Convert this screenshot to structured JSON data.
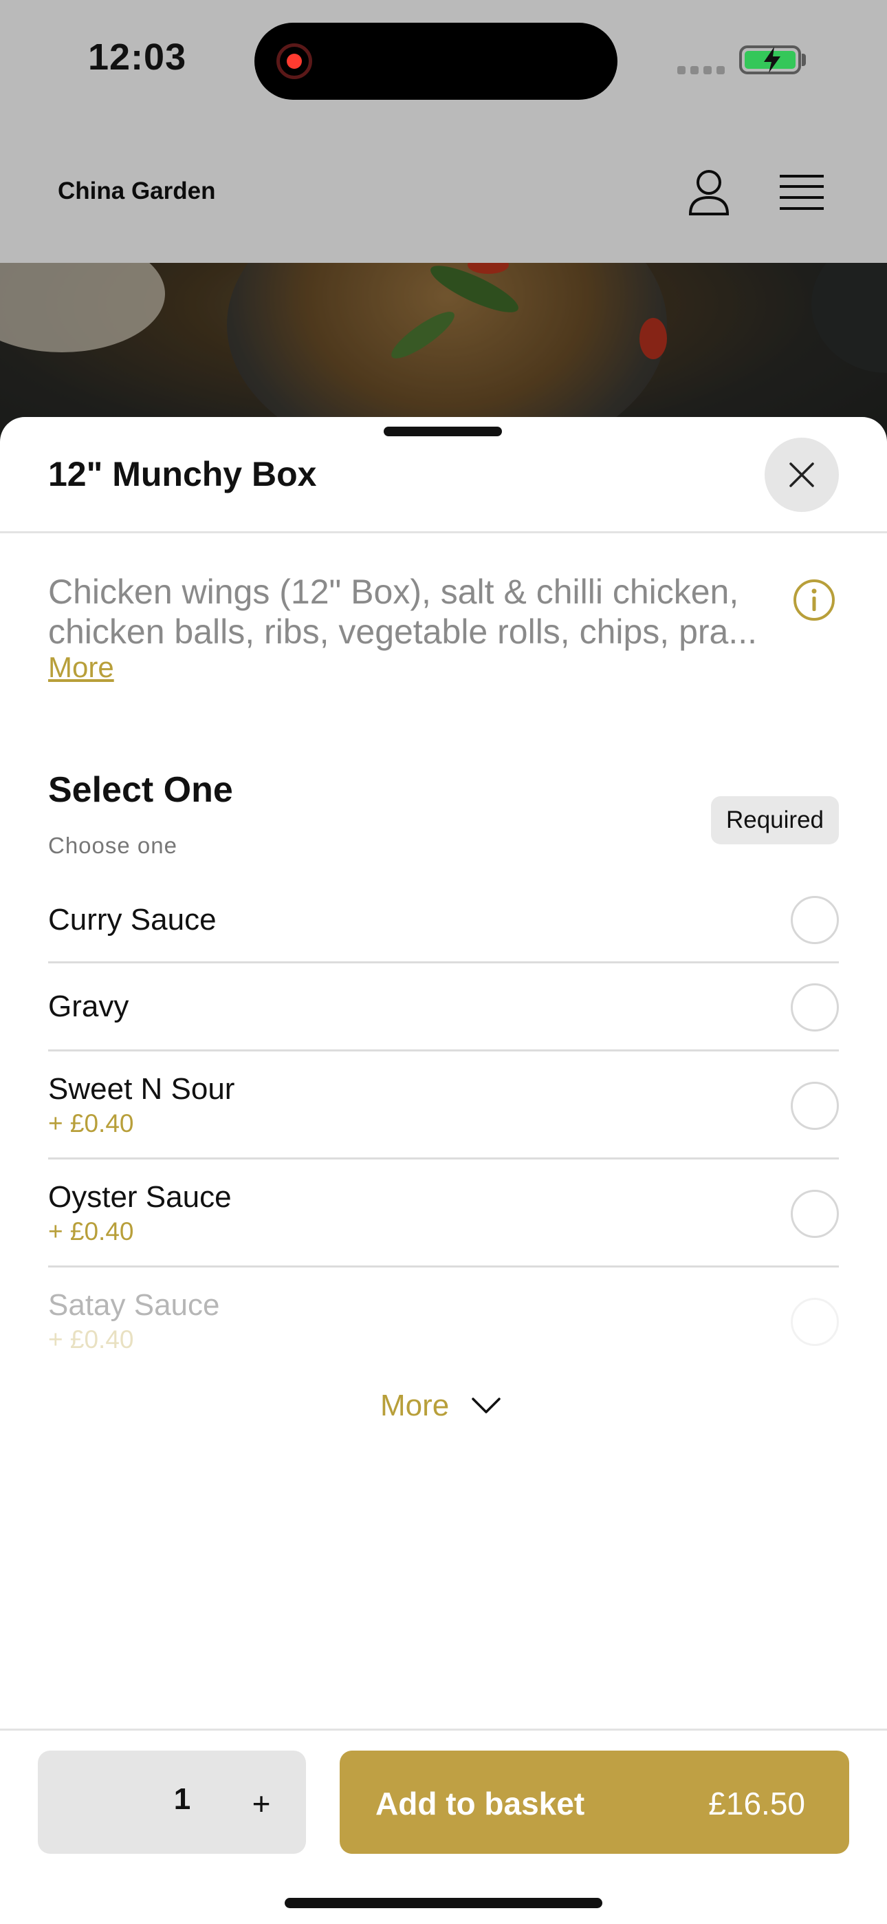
{
  "status_bar": {
    "time": "12:03"
  },
  "header": {
    "restaurant_name": "China Garden"
  },
  "item": {
    "title": "12\" Munchy Box",
    "description_line1": "Chicken wings (12\" Box), salt & chilli chicken,",
    "description_line2": "chicken balls, ribs, vegetable rolls, chips, pra...",
    "more_link": "More"
  },
  "section": {
    "title": "Select One",
    "subtitle": "Choose one",
    "badge": "Required",
    "options": [
      {
        "name": "Curry Sauce",
        "price": ""
      },
      {
        "name": "Gravy",
        "price": ""
      },
      {
        "name": "Sweet N Sour",
        "price": "+ £0.40"
      },
      {
        "name": "Oyster Sauce",
        "price": "+ £0.40"
      },
      {
        "name": "Satay Sauce",
        "price": "+ £0.40"
      }
    ],
    "more_label": "More"
  },
  "footer": {
    "quantity": "1",
    "plus_label": "+",
    "add_label": "Add to basket",
    "total": "£16.50"
  },
  "colors": {
    "accent": "#bfa044",
    "price_text": "#b89f3a"
  }
}
